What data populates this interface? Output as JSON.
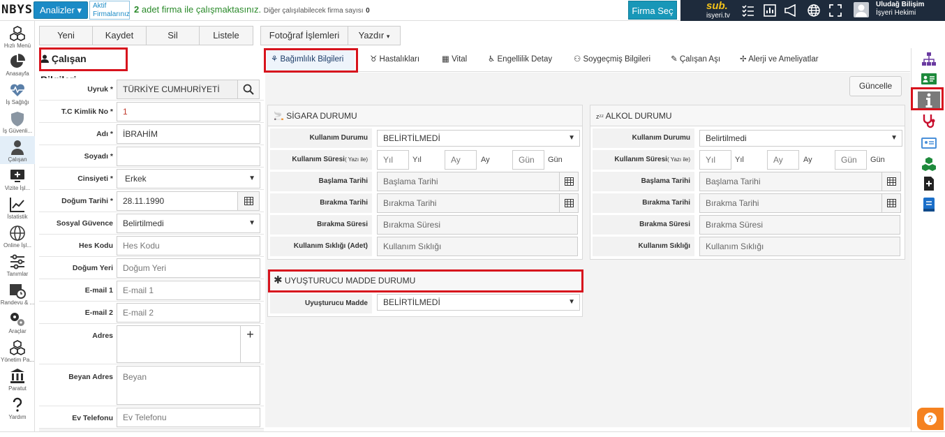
{
  "topbar": {
    "logo": "NBYS",
    "analiz_label": "Analizler",
    "aktif_line1": "Aktif",
    "aktif_line2": "Firmalarınız",
    "firma_count": "2",
    "firma_text": "adet firma ile çalışmaktasınız.",
    "firma_extra": "Diğer çalışılabilecek firma sayısı",
    "firma_extra_count": "0",
    "firma_sec": "Firma Seç",
    "brand_top": "sub.",
    "brand_bottom": "isyeri.tv",
    "user_name": "Uludağ Bilişim",
    "user_role": "İşyeri Hekimi"
  },
  "leftnav": [
    {
      "label": "Hızlı Menü",
      "icon": "cubes-icon"
    },
    {
      "label": "Anasayfa",
      "icon": "pie-chart-icon"
    },
    {
      "label": "İş Sağlığı",
      "icon": "heartbeat-icon"
    },
    {
      "label": "İş Güvenli...",
      "icon": "shield-icon"
    },
    {
      "label": "Çalışan",
      "icon": "user-icon"
    },
    {
      "label": "Vizite İşl...",
      "icon": "medical-monitor-icon"
    },
    {
      "label": "İstatistik",
      "icon": "line-chart-icon"
    },
    {
      "label": "Online İşl...",
      "icon": "globe-icon"
    },
    {
      "label": "Tanımlar",
      "icon": "sliders-icon"
    },
    {
      "label": "Randevu & ...",
      "icon": "calendar-clock-icon"
    },
    {
      "label": "Araçlar",
      "icon": "gears-icon"
    },
    {
      "label": "Yönetim Pa...",
      "icon": "cubes-icon"
    },
    {
      "label": "Paratut",
      "icon": "bank-icon"
    },
    {
      "label": "Yardım",
      "icon": "question-icon"
    }
  ],
  "toolbar": {
    "yeni": "Yeni",
    "kaydet": "Kaydet",
    "sil": "Sil",
    "listele": "Listele",
    "fotograf": "Fotoğraf İşlemleri",
    "yazdir": "Yazdır"
  },
  "employee": {
    "title": "Çalışan Bilgileri",
    "uyruk_label": "Uyruk *",
    "uyruk_value": "TÜRKİYE CUMHURİYETİ",
    "tc_label": "T.C Kimlik No *",
    "tc_value": "1",
    "adi_label": "Adı *",
    "adi_value": "İBRAHİM",
    "soyadi_label": "Soyadı *",
    "soyadi_value": "",
    "cinsiyet_label": "Cinsiyeti *",
    "cinsiyet_value": "Erkek",
    "dogum_label": "Doğum Tarihi *",
    "dogum_value": "28.11.1990",
    "sosyal_label": "Sosyal Güvence",
    "sosyal_value": "Belirtilmedi",
    "hes_label": "Hes Kodu",
    "hes_placeholder": "Hes Kodu",
    "dogum_yeri_label": "Doğum Yeri",
    "dogum_yeri_placeholder": "Doğum Yeri",
    "email1_label": "E-mail 1",
    "email1_placeholder": "E-mail 1",
    "email2_label": "E-mail 2",
    "email2_placeholder": "E-mail 2",
    "adres_label": "Adres",
    "beyan_label": "Beyan Adres",
    "beyan_placeholder": "Beyan",
    "ev_label": "Ev Telefonu",
    "ev_placeholder": "Ev Telefonu"
  },
  "tabs": [
    "Bağımlılık Bilgileri",
    "Hastalıkları",
    "Vital",
    "Engellilik Detay",
    "Soygeçmiş Bilgileri",
    "Çalışan Aşı",
    "Alerji ve Ameliyatlar"
  ],
  "guncelle": "Güncelle",
  "sigara": {
    "title": "SİGARA DURUMU",
    "kullanim_durumu_label": "Kullanım Durumu",
    "kullanim_durumu_value": "BELİRTİLMEDİ",
    "kullanim_suresi_label": "Kullanım Süresi",
    "kullanim_suresi_hint": "( Yazı ile)",
    "yil_ph": "Yıl",
    "yil_unit": "Yıl",
    "ay_ph": "Ay",
    "ay_unit": "Ay",
    "gun_ph": "Gün",
    "gun_unit": "Gün",
    "baslama_label": "Başlama Tarihi",
    "baslama_ph": "Başlama Tarihi",
    "birakma_label": "Bırakma Tarihi",
    "birakma_ph": "Bırakma Tarihi",
    "birakma_suresi_label": "Bırakma Süresi",
    "birakma_suresi_ph": "Bırakma Süresi",
    "siklik_label": "Kullanım Sıklığı (Adet)",
    "siklik_ph": "Kullanım Sıklığı"
  },
  "alkol": {
    "title": "ALKOL DURUMU",
    "kullanim_durumu_label": "Kullanım Durumu",
    "kullanim_durumu_value": "Belirtilmedi",
    "kullanim_suresi_label": "Kullanım Süresi",
    "kullanim_suresi_hint": "( Yazı ile)",
    "yil_ph": "Yıl",
    "yil_unit": "Yıl",
    "ay_ph": "Ay",
    "ay_unit": "Ay",
    "gun_ph": "Gün",
    "gun_unit": "Gün",
    "baslama_label": "Başlama Tarihi",
    "baslama_ph": "Başlama Tarihi",
    "birakma_label": "Bırakma Tarihi",
    "birakma_ph": "Bırakma Tarihi",
    "birakma_suresi_label": "Bırakma Süresi",
    "birakma_suresi_ph": "Bırakma Süresi",
    "siklik_label": "Kullanım Sıklığı",
    "siklik_ph": "Kullanım Sıklığı"
  },
  "uyusturucu": {
    "title": "UYUŞTURUCU MADDE DURUMU",
    "madde_label": "Uyuşturucu Madde",
    "madde_value": "BELİRTİLMEDİ"
  },
  "colors": {
    "accent": "#1b8bc6",
    "highlight": "#d7131d",
    "dark": "#1e2b3c",
    "help": "#f58220"
  }
}
